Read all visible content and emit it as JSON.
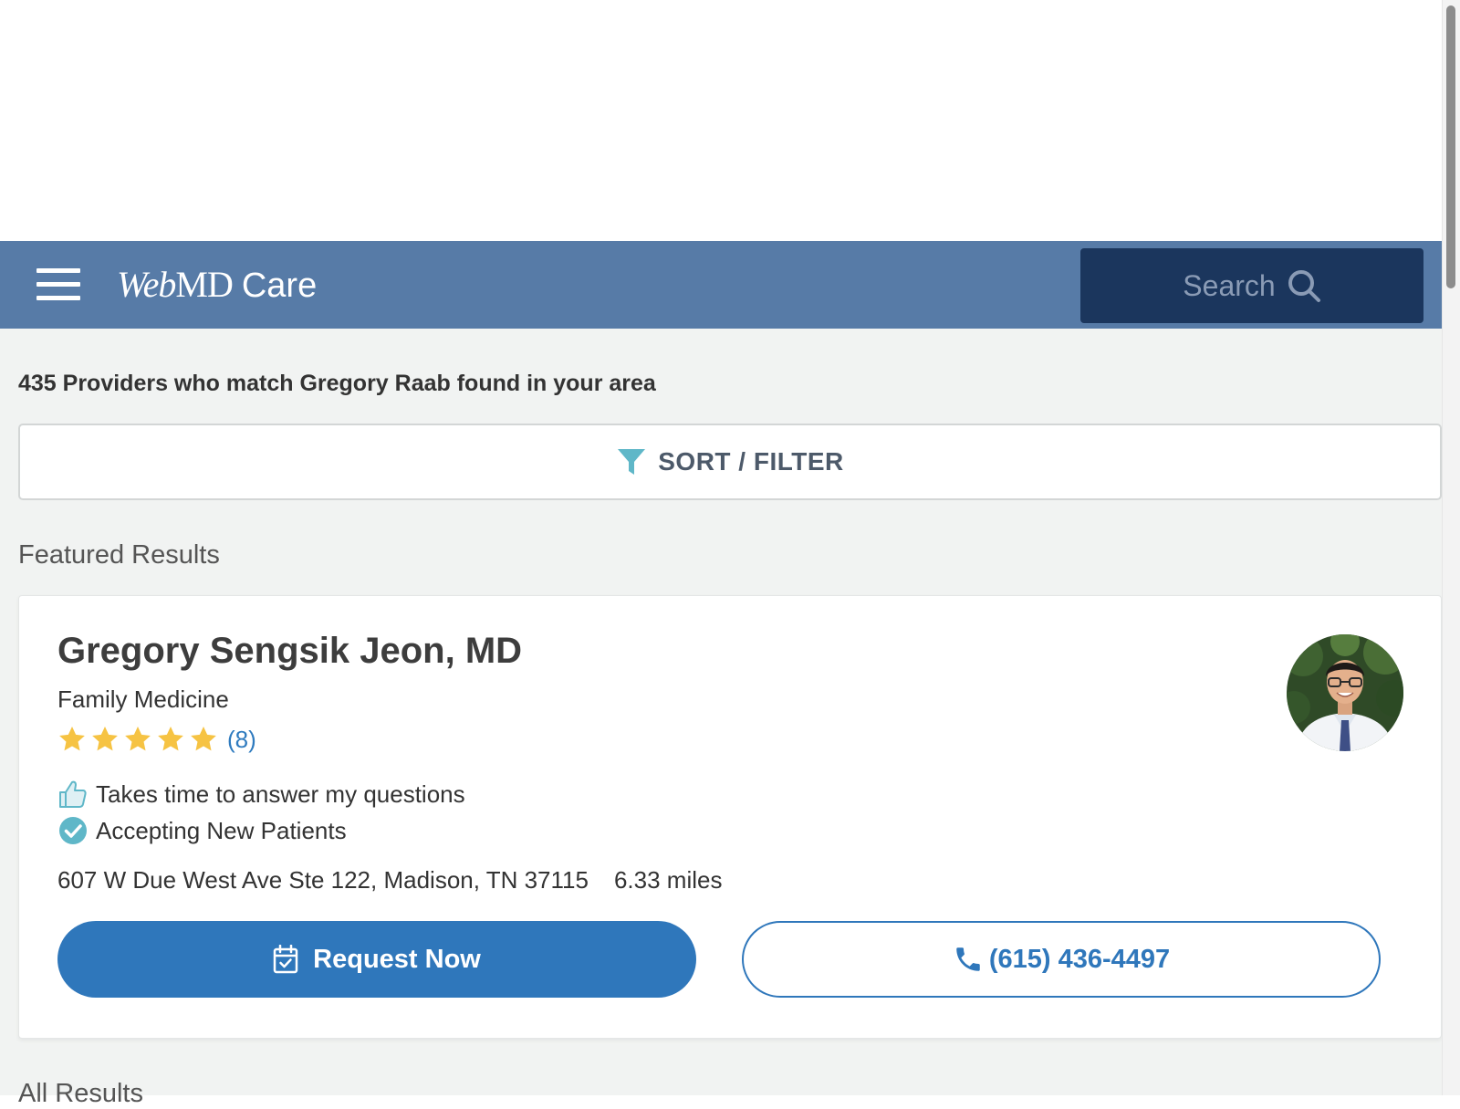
{
  "header": {
    "logo_web": "Web",
    "logo_md": "MD",
    "logo_care": "Care",
    "search_label": "Search"
  },
  "results": {
    "match_text": "435 Providers who match Gregory Raab found in your area",
    "sort_filter_label": "SORT / FILTER",
    "featured_heading": "Featured Results",
    "all_results_heading": "All Results"
  },
  "featured_provider": {
    "name": "Gregory Sengsik Jeon, MD",
    "specialty": "Family Medicine",
    "rating_stars": 5,
    "rating_count": "(8)",
    "highlight": "Takes time to answer my questions",
    "accepting": "Accepting New Patients",
    "address": "607 W Due West Ave Ste 122, Madison, TN 37115",
    "distance": "6.33 miles",
    "request_label": "Request Now",
    "phone": "(615) 436-4497"
  },
  "icons": {
    "menu": "hamburger-menu-icon",
    "search": "magnifier-icon",
    "filter": "funnel-icon",
    "star": "star-icon",
    "thumbs_up": "thumbs-up-icon",
    "check": "check-circle-icon",
    "calendar": "calendar-check-icon",
    "phone": "phone-icon"
  },
  "colors": {
    "header_bg": "#577ba7",
    "search_bg": "#1b365d",
    "page_bg": "#f1f3f2",
    "primary_blue": "#2f77bb",
    "star_gold": "#f6c343",
    "accent_teal": "#5fb7c8"
  }
}
